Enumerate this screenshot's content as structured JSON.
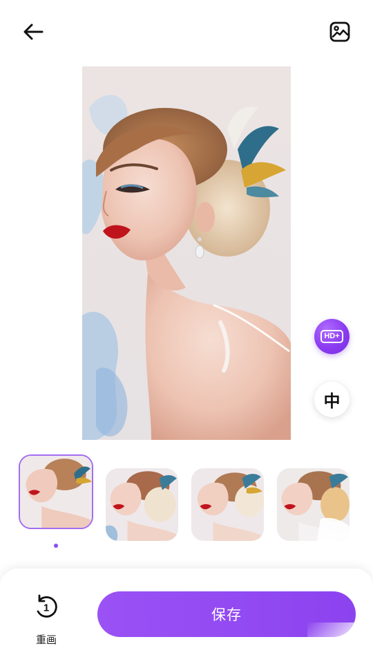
{
  "header": {
    "back_icon": "arrow-left-icon",
    "gallery_icon": "image-gallery-icon"
  },
  "main_image": {
    "icon": "portrait-artwork"
  },
  "side_buttons": {
    "hd_label": "HD+",
    "hd_color": "#8b3bf0",
    "language_label": "中"
  },
  "thumbnails": {
    "count": 4,
    "selected_index": 0,
    "indicator_color": "#8b4cf0"
  },
  "bottom_bar": {
    "redraw_label": "重画",
    "redraw_badge": "1",
    "redraw_icon": "redo-circle-icon",
    "save_label": "保存",
    "save_color": "#9a52f5"
  }
}
